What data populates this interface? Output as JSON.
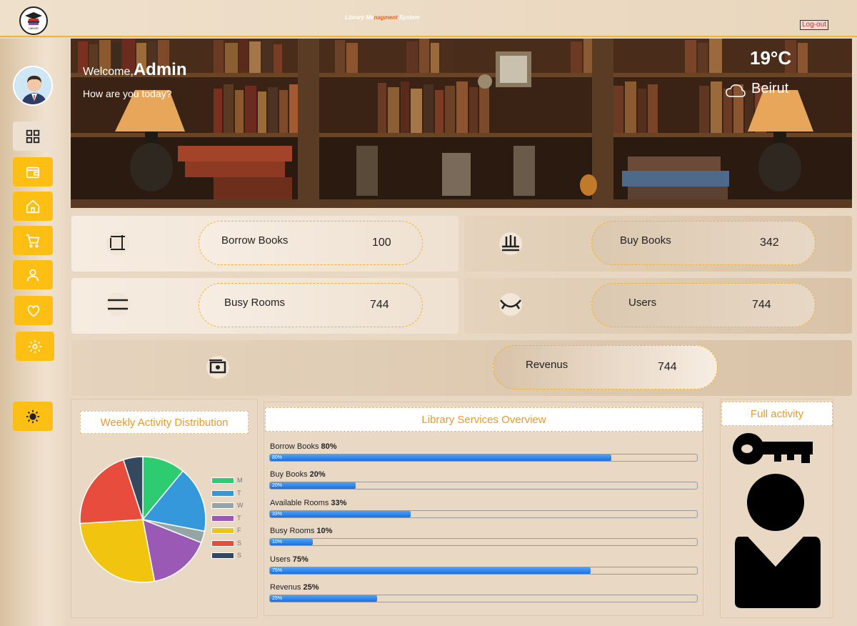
{
  "header": {
    "title_parts": [
      "Library Me",
      "nagment",
      " System"
    ],
    "logo_text": "LIBRARY",
    "logout_label": "Log-out"
  },
  "sidebar": {
    "items": [
      {
        "name": "dashboard",
        "icon": "grid-icon",
        "active": true
      },
      {
        "name": "wallet",
        "icon": "wallet-icon"
      },
      {
        "name": "home",
        "icon": "home-icon"
      },
      {
        "name": "cart",
        "icon": "cart-icon"
      },
      {
        "name": "user",
        "icon": "user-icon"
      },
      {
        "name": "favorites",
        "icon": "heart-icon"
      },
      {
        "name": "settings",
        "icon": "gear-icon"
      }
    ],
    "theme_toggle_icon": "sun-icon"
  },
  "banner": {
    "welcome": "Welcome,",
    "user": "Admin",
    "greeting": "How are you today?",
    "temperature": "19°C",
    "city": "Beirut"
  },
  "stats": {
    "borrow_books": {
      "label": "Borrow Books",
      "value": "100"
    },
    "buy_books": {
      "label": "Buy Books",
      "value": "342"
    },
    "busy_rooms": {
      "label": "Busy Rooms",
      "value": "744"
    },
    "users": {
      "label": "Users",
      "value": "744"
    },
    "revenue": {
      "label": "Revenus",
      "value": "744"
    }
  },
  "weekly": {
    "title": "Weekly Activity Distribution"
  },
  "chart_data": {
    "type": "pie",
    "title": "Weekly Activity Distribution",
    "categories": [
      "M",
      "T",
      "W",
      "T",
      "F",
      "S",
      "S"
    ],
    "values": [
      11,
      17,
      3,
      16,
      27,
      21,
      5
    ],
    "colors": [
      "#2ecc71",
      "#3498db",
      "#95a5a6",
      "#9b59b6",
      "#f1c40f",
      "#e74c3c",
      "#34495e"
    ],
    "legend": "right"
  },
  "services": {
    "title": "Library Services Overview",
    "items": [
      {
        "label": "Borrow Books",
        "pct": 80,
        "pct_text": "80%"
      },
      {
        "label": "Buy Books",
        "pct": 20,
        "pct_text": "20%"
      },
      {
        "label": "Available Rooms",
        "pct": 33,
        "pct_text": "33%"
      },
      {
        "label": "Busy Rooms",
        "pct": 10,
        "pct_text": "10%"
      },
      {
        "label": "Users",
        "pct": 75,
        "pct_text": "75%"
      },
      {
        "label": "Revenus",
        "pct": 25,
        "pct_text": "25%"
      }
    ]
  },
  "activity": {
    "title": "Full activity"
  }
}
